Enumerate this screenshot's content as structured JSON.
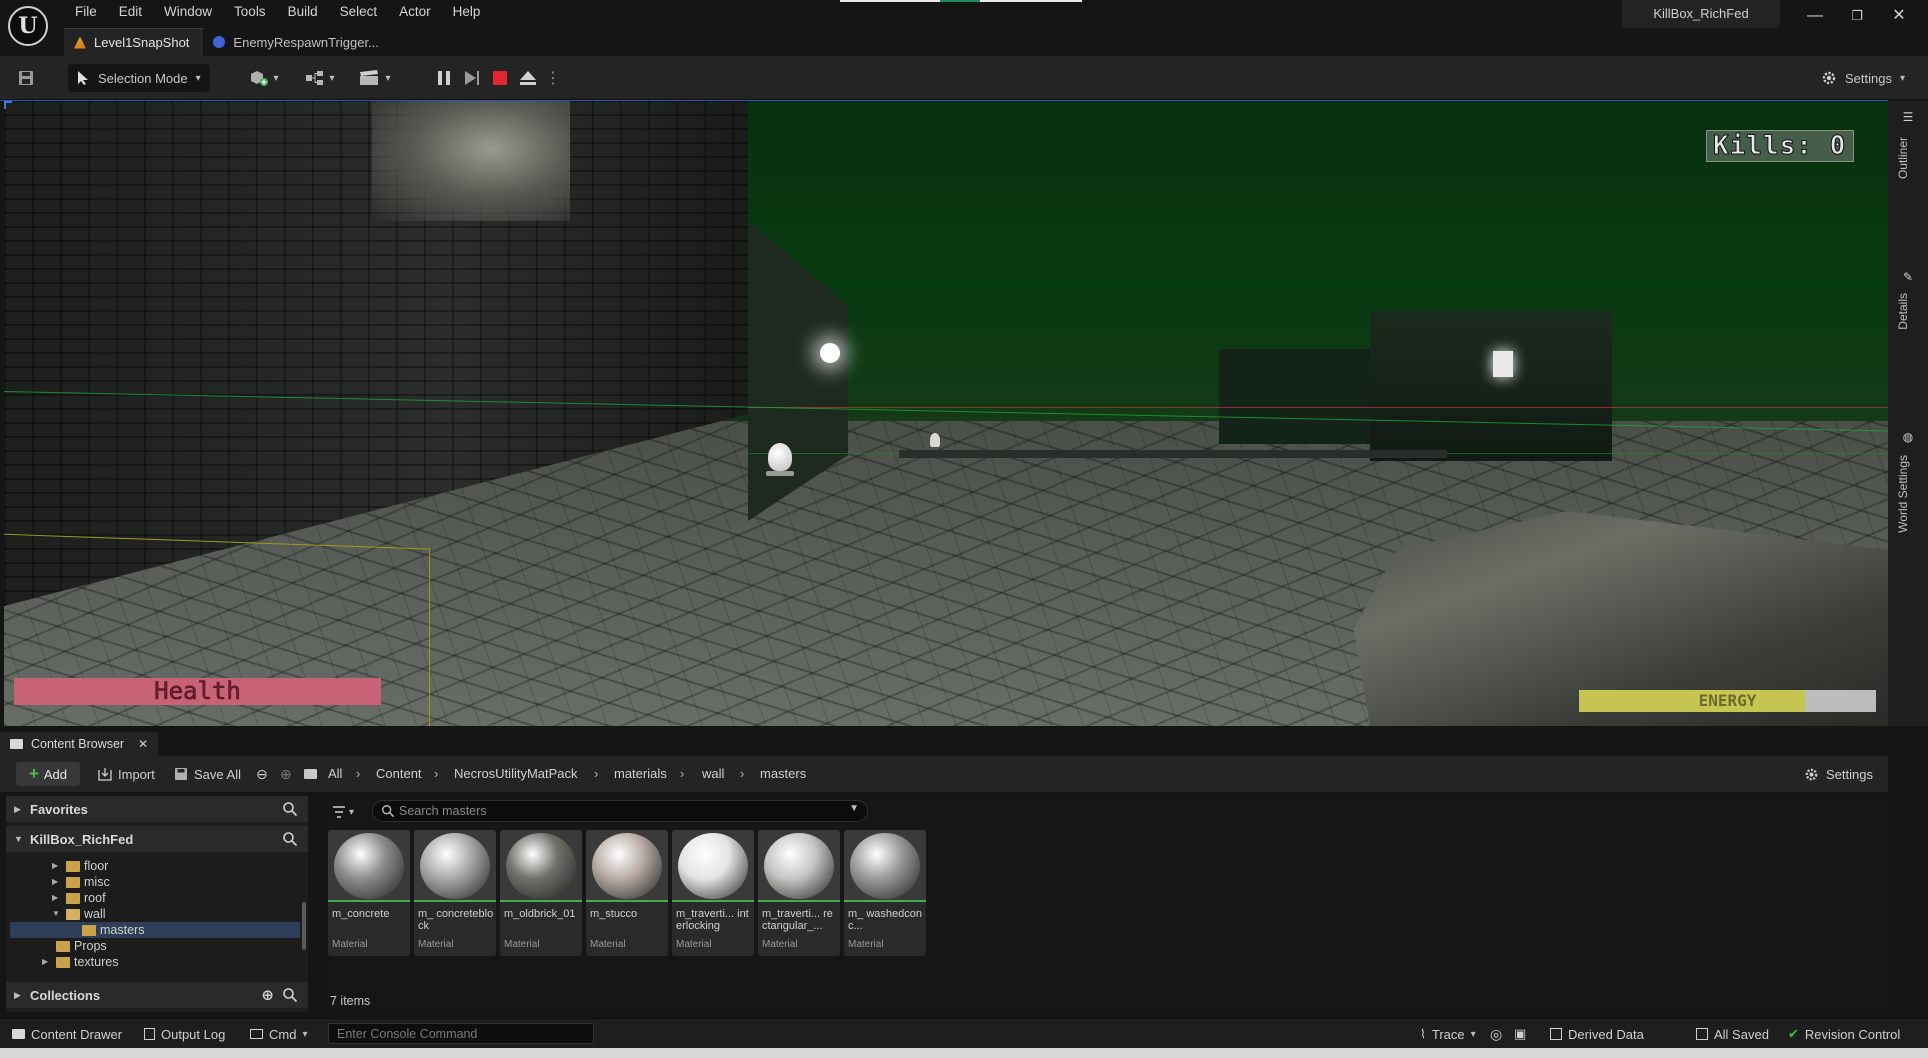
{
  "app": {
    "logo_text": "U",
    "project_name": "KillBox_RichFed"
  },
  "menu": [
    "File",
    "Edit",
    "Window",
    "Tools",
    "Build",
    "Select",
    "Actor",
    "Help"
  ],
  "window_controls": {
    "minimize": "—",
    "restore": "❐",
    "close": "✕"
  },
  "tabs": [
    {
      "label": "Level1SnapShot",
      "active": true
    },
    {
      "label": "EnemyRespawnTrigger...",
      "active": false
    }
  ],
  "toolbar": {
    "selection_mode": "Selection Mode",
    "settings": "Settings"
  },
  "hud": {
    "kills": "Kills: 0",
    "health": "Health",
    "energy_label": "ENERGY",
    "energy_level": 0.76
  },
  "side_tabs": [
    "Outliner",
    "Details",
    "World Settings"
  ],
  "content_browser": {
    "tab_label": "Content Browser",
    "add": "Add",
    "import": "Import",
    "save_all": "Save All",
    "breadcrumb": [
      "All",
      "Content",
      "NecrosUtilityMatPack",
      "materials",
      "wall",
      "masters"
    ],
    "settings": "Settings",
    "favorites": "Favorites",
    "project_root": "KillBox_RichFed",
    "tree": [
      {
        "label": "floor",
        "open": false
      },
      {
        "label": "misc",
        "open": false
      },
      {
        "label": "roof",
        "open": false
      },
      {
        "label": "wall",
        "open": true
      },
      {
        "label": "masters",
        "open": false
      },
      {
        "label": "Props",
        "open": false
      },
      {
        "label": "textures",
        "open": false
      }
    ],
    "collections": "Collections",
    "search_placeholder": "Search masters",
    "assets": [
      {
        "name": "m_concrete",
        "type": "Material",
        "color": "#8c8c8a"
      },
      {
        "name": "m_ concreteblock",
        "type": "Material",
        "color": "#a8aaa8"
      },
      {
        "name": "m_oldbrick_01",
        "type": "Material",
        "color": "#6e726a"
      },
      {
        "name": "m_stucco",
        "type": "Material",
        "color": "#b8aca4"
      },
      {
        "name": "m_traverti... interlocking",
        "type": "Material",
        "color": "#e4e4e2"
      },
      {
        "name": "m_traverti... rectangular_...",
        "type": "Material",
        "color": "#c4c6c2"
      },
      {
        "name": "m_ washedconc...",
        "type": "Material",
        "color": "#9a9a98"
      }
    ],
    "item_count": "7 items"
  },
  "statusbar": {
    "content_drawer": "Content Drawer",
    "output_log": "Output Log",
    "cmd": "Cmd",
    "console_placeholder": "Enter Console Command",
    "trace": "Trace",
    "derived_data": "Derived Data",
    "all_saved": "All Saved",
    "revision_control": "Revision Control"
  }
}
